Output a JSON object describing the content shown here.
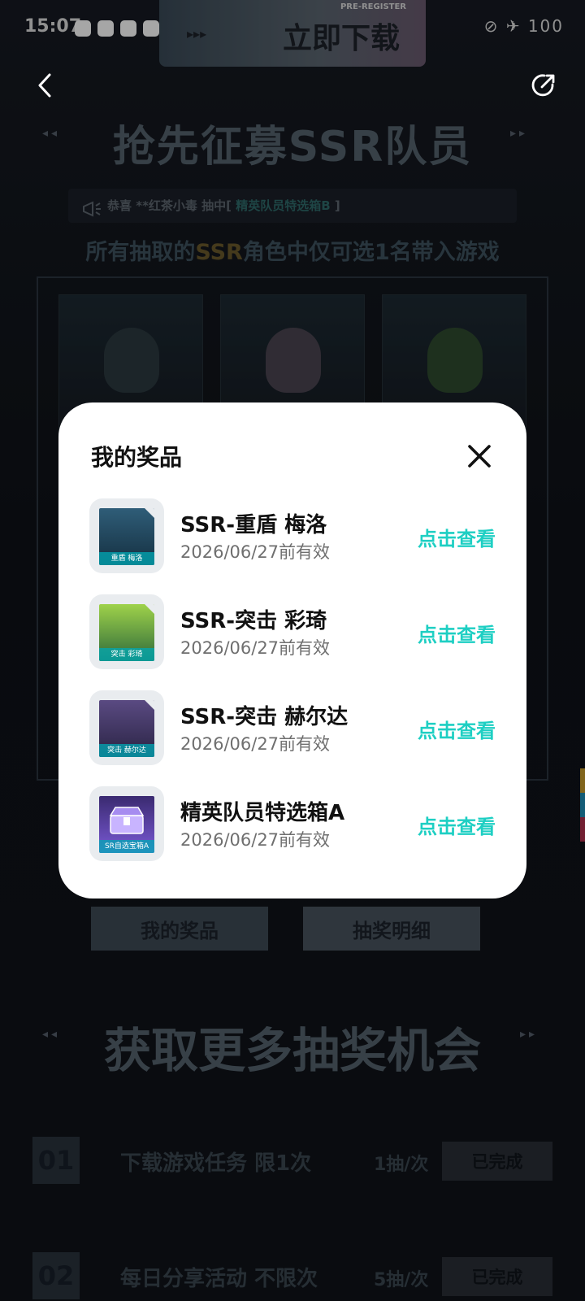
{
  "status_bar": {
    "time": "15:07",
    "right_text": "⊘ ✈ 100"
  },
  "banner": {
    "pre_register": "PRE-REGISTER",
    "download_label": "立即下载",
    "arrows": "▸▸▸"
  },
  "nav": {
    "back_icon": "chevron-left-icon",
    "share_icon": "share-icon"
  },
  "page": {
    "title_1": "抢先征募SSR队员",
    "ticker": {
      "prefix": "恭喜 **红茶小毒 抽中[ ",
      "highlight": "精英队员特选箱B",
      "suffix": " ]"
    },
    "subtitle": {
      "part1": "所有抽取的",
      "ssr": "SSR",
      "part2": "角色中仅可选1名带入游戏"
    },
    "buttons": {
      "my_prizes": "我的奖品",
      "lottery_detail": "抽奖明细"
    },
    "title_2": "获取更多抽奖机会",
    "tasks": [
      {
        "num": "01",
        "name": "下载游戏任务 限1次",
        "reward": "1抽/次",
        "status": "已完成"
      },
      {
        "num": "02",
        "name": "每日分享活动 不限次",
        "reward": "5抽/次",
        "status": "已完成"
      }
    ]
  },
  "modal": {
    "title": "我的奖品",
    "close_icon": "close-icon",
    "items": [
      {
        "name": "SSR-重盾 梅洛",
        "date": "2026/06/27前有效",
        "link": "点击查看",
        "thumb_caption": "重盾 梅洛",
        "thumb_color": "#2e5a70"
      },
      {
        "name": "SSR-突击 彩琦",
        "date": "2026/06/27前有效",
        "link": "点击查看",
        "thumb_caption": "突击 彩琦",
        "thumb_color": "#3a6a3c"
      },
      {
        "name": "SSR-突击 赫尔达",
        "date": "2026/06/27前有效",
        "link": "点击查看",
        "thumb_caption": "突击 赫尔达",
        "thumb_color": "#4a3d6a"
      },
      {
        "name": "精英队员特选箱A",
        "date": "2026/06/27前有效",
        "link": "点击查看",
        "thumb_caption": "SR自选宝箱A",
        "thumb_color": "#6a4bb0"
      }
    ]
  },
  "colors": {
    "accent": "#1ecfc3",
    "modal_bg": "#ffffff",
    "page_bg": "#0c0d12"
  }
}
